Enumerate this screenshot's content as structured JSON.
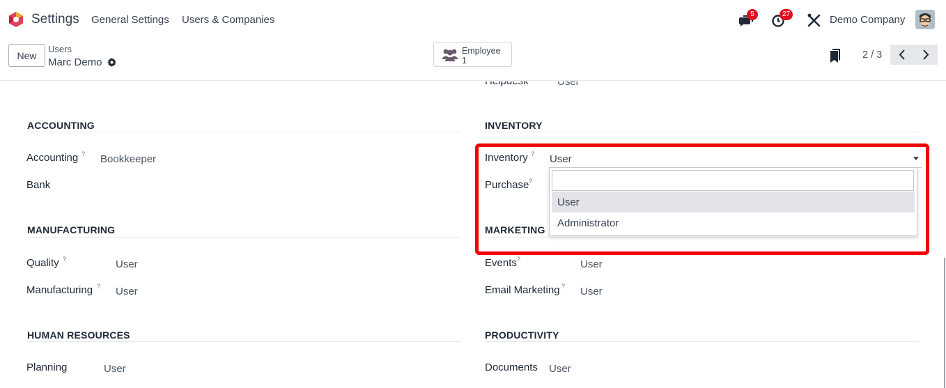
{
  "navbar": {
    "app_title": "Settings",
    "menu": [
      "General Settings",
      "Users & Companies"
    ],
    "messages_count": "5",
    "activities_count": "27",
    "company": "Demo Company"
  },
  "control_panel": {
    "new_label": "New",
    "breadcrumb_parent": "Users",
    "breadcrumb_current": "Marc Demo",
    "smart_button": {
      "label": "Employee",
      "count": "1"
    },
    "pager": "2 / 3"
  },
  "form": {
    "top_partial": {
      "label": "Helpdesk",
      "value": "User"
    },
    "accounting": {
      "title": "ACCOUNTING",
      "fields": [
        {
          "label": "Accounting",
          "help": "?",
          "value": "Bookkeeper"
        },
        {
          "label": "Bank",
          "help": "",
          "value": ""
        }
      ]
    },
    "inventory": {
      "title": "INVENTORY",
      "fields": [
        {
          "label": "Inventory",
          "help": "?",
          "value": "User"
        },
        {
          "label": "Purchase",
          "help": "?",
          "value": ""
        }
      ]
    },
    "manufacturing": {
      "title": "MANUFACTURING",
      "fields": [
        {
          "label": "Quality",
          "help": "?",
          "value": "User"
        },
        {
          "label": "Manufacturing",
          "help": "?",
          "value": "User"
        }
      ]
    },
    "marketing": {
      "title": "MARKETING",
      "fields": [
        {
          "label": "Events",
          "help": "?",
          "value": "User"
        },
        {
          "label": "Email Marketing",
          "help": "?",
          "value": "User"
        }
      ]
    },
    "human_resources": {
      "title": "HUMAN RESOURCES",
      "fields": [
        {
          "label": "Planning",
          "help": "",
          "value": "User"
        }
      ]
    },
    "productivity": {
      "title": "PRODUCTIVITY",
      "fields": [
        {
          "label": "Documents",
          "help": "",
          "value": "User"
        }
      ]
    }
  },
  "dropdown": {
    "search_value": "",
    "options": [
      "User",
      "Administrator"
    ],
    "selected": "User"
  },
  "colors": {
    "highlight": "#f20000",
    "badge": "#e0101e",
    "option_active": "#e4e3e8"
  },
  "icons": [
    "odoo-logo-icon",
    "chat-icon",
    "clock-icon",
    "tools-icon",
    "gear-icon",
    "users-icon",
    "bookmark-icon",
    "chevron-left-icon",
    "chevron-right-icon",
    "caret-down-icon"
  ]
}
